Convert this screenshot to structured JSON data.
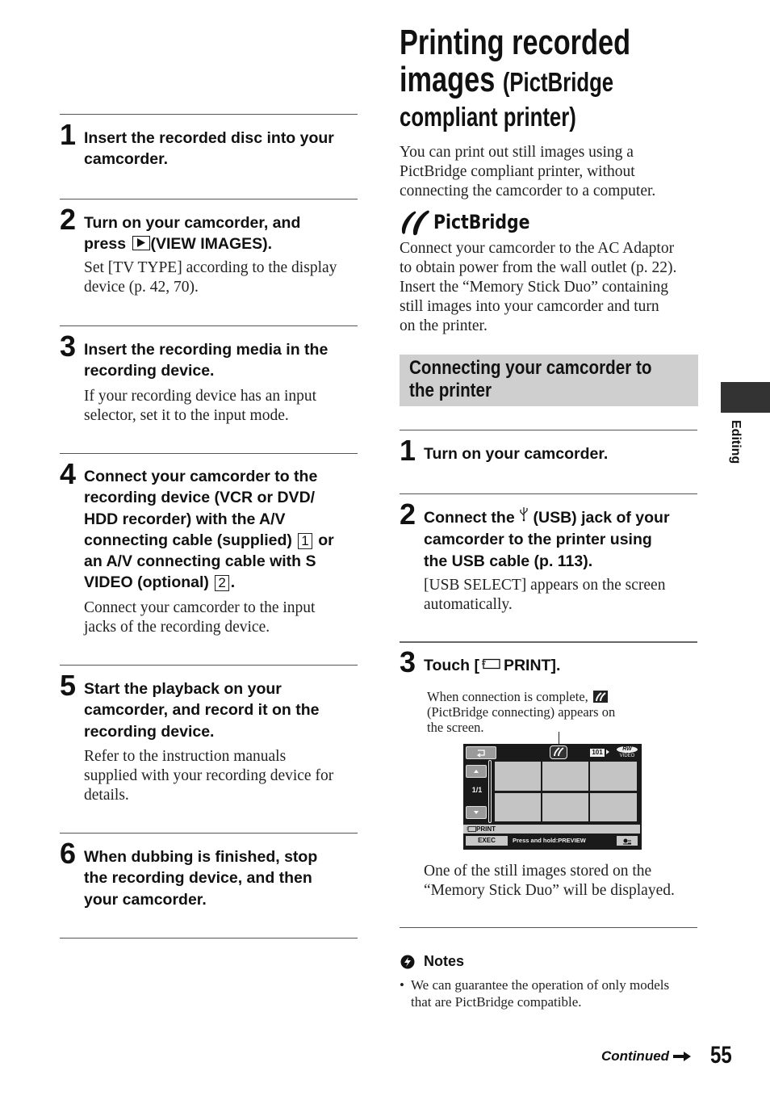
{
  "left_steps": [
    {
      "num": "1",
      "heading": "Insert the recorded disc into your camcorder.",
      "heading_lines": [
        "Insert the recorded disc into your",
        "camcorder."
      ],
      "body_lines": []
    },
    {
      "num": "2",
      "heading_lines": [
        "Turn on your camcorder, and",
        "press",
        "(VIEW IMAGES)."
      ],
      "icon": "play-button-icon",
      "body_lines": [
        "Set [TV TYPE] according to the display",
        "device (p. 42, 70)."
      ]
    },
    {
      "num": "3",
      "heading_lines": [
        "Insert the recording media in the",
        "recording device."
      ],
      "body_lines": [
        "If your recording device has an input",
        "selector, set it to the input mode."
      ]
    },
    {
      "num": "4",
      "heading_lines": [
        "Connect your camcorder to the",
        "recording device (VCR or DVD/",
        "HDD recorder) with the A/V",
        "connecting cable (supplied)",
        "or",
        "an A/V connecting cable with S",
        "VIDEO (optional)",
        "."
      ],
      "box_labels": [
        "1",
        "2"
      ],
      "body_lines": [
        "Connect your camcorder to the input",
        "jacks of the recording device."
      ]
    },
    {
      "num": "5",
      "heading_lines": [
        "Start the playback on your",
        "camcorder, and record it on the",
        "recording device."
      ],
      "body_lines": [
        "Refer to the instruction manuals",
        "supplied with your recording device for",
        "details."
      ]
    },
    {
      "num": "6",
      "heading_lines": [
        "When dubbing is finished, stop",
        "the recording device, and then",
        "your camcorder."
      ],
      "body_lines": []
    }
  ],
  "title": {
    "line1": "Printing recorded",
    "line2_main": "images",
    "line2_sub": "(PictBridge",
    "line3": "compliant printer)"
  },
  "intro_lines": [
    "You can print out still images using a",
    "PictBridge compliant printer, without",
    "connecting the camcorder to a computer."
  ],
  "pictbridge_logo": "PictBridge",
  "pictbridge_para_lines": [
    "Connect your camcorder to the AC Adaptor",
    "to obtain power from the wall outlet (p. 22).",
    "Insert the “Memory Stick Duo” containing",
    "still images into your camcorder and turn",
    "on the printer."
  ],
  "section_heading_lines": [
    "Connecting your camcorder to",
    "the printer"
  ],
  "right_steps": [
    {
      "num": "1",
      "heading_lines": [
        "Turn on your camcorder."
      ],
      "body_lines": []
    },
    {
      "num": "2",
      "heading_lines": [
        "Connect the",
        "(USB) jack of your",
        "camcorder to the printer using",
        "the USB cable (p. 113)."
      ],
      "icon": "usb-icon",
      "body_lines": [
        "[USB SELECT] appears on the screen",
        "automatically."
      ]
    },
    {
      "num": "3",
      "heading_pre": "Touch [",
      "heading_post": "PRINT].",
      "icon": "print-icon",
      "body_lines": []
    }
  ],
  "callout_lines": [
    "When connection is complete,",
    "(PictBridge connecting) appears on",
    "the screen."
  ],
  "camera_screen": {
    "folder": "101",
    "disc": "RW",
    "disc_sub": "VIDEO",
    "page": "1/1",
    "mode_label": "PRINT",
    "exec_label": "EXEC",
    "hint": "Press and hold:PREVIEW"
  },
  "after_screen_lines": [
    "One of the still images stored on the",
    "“Memory Stick Duo” will be displayed."
  ],
  "notes": {
    "heading": "Notes",
    "items": [
      {
        "lines": [
          "We can guarantee the operation of only models",
          "that are PictBridge compatible."
        ]
      }
    ]
  },
  "side_tab_label": "Editing",
  "footer": {
    "continued": "Continued",
    "page_number": "55"
  }
}
